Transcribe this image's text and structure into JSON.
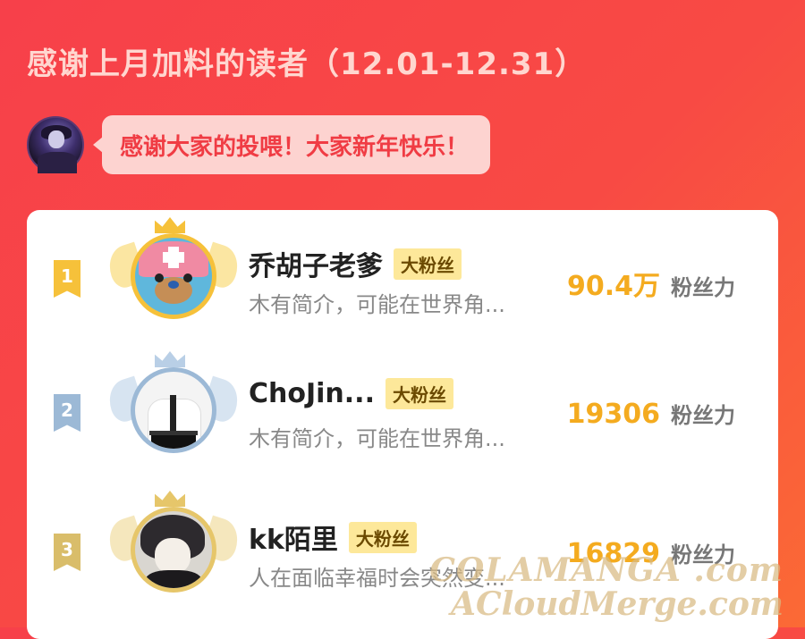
{
  "header": {
    "title": "感谢上月加料的读者（12.01-12.31）",
    "author_message": "感谢大家的投喂！大家新年快乐！"
  },
  "colors": {
    "background": "#f84a44",
    "badge": "#fde89a",
    "fans_number": "#f4ab1f",
    "rank_gold": "#f6c13a",
    "rank_silver": "#9cb9d6",
    "rank_bronze": "#e6c66a"
  },
  "ranking": [
    {
      "rank": "1",
      "name": "乔胡子老爹",
      "badge": "大粉丝",
      "description": "木有简介，可能在世界角...",
      "fans_value": "90.4万",
      "fans_unit": "粉丝力",
      "avatar": "chopper-avatar"
    },
    {
      "rank": "2",
      "name": "ChoJin...",
      "badge": "大粉丝",
      "description": "木有简介，可能在世界角...",
      "fans_value": "19306",
      "fans_unit": "粉丝力",
      "avatar": "shirt-avatar"
    },
    {
      "rank": "3",
      "name": "kk陌里",
      "badge": "大粉丝",
      "description": "人在面临幸福时会突然变...",
      "fans_value": "16829",
      "fans_unit": "粉丝力",
      "avatar": "anime-boy-avatar"
    }
  ],
  "watermark": {
    "line1": "COLAMANGA .com",
    "line2": "ACloudMerge.com"
  }
}
